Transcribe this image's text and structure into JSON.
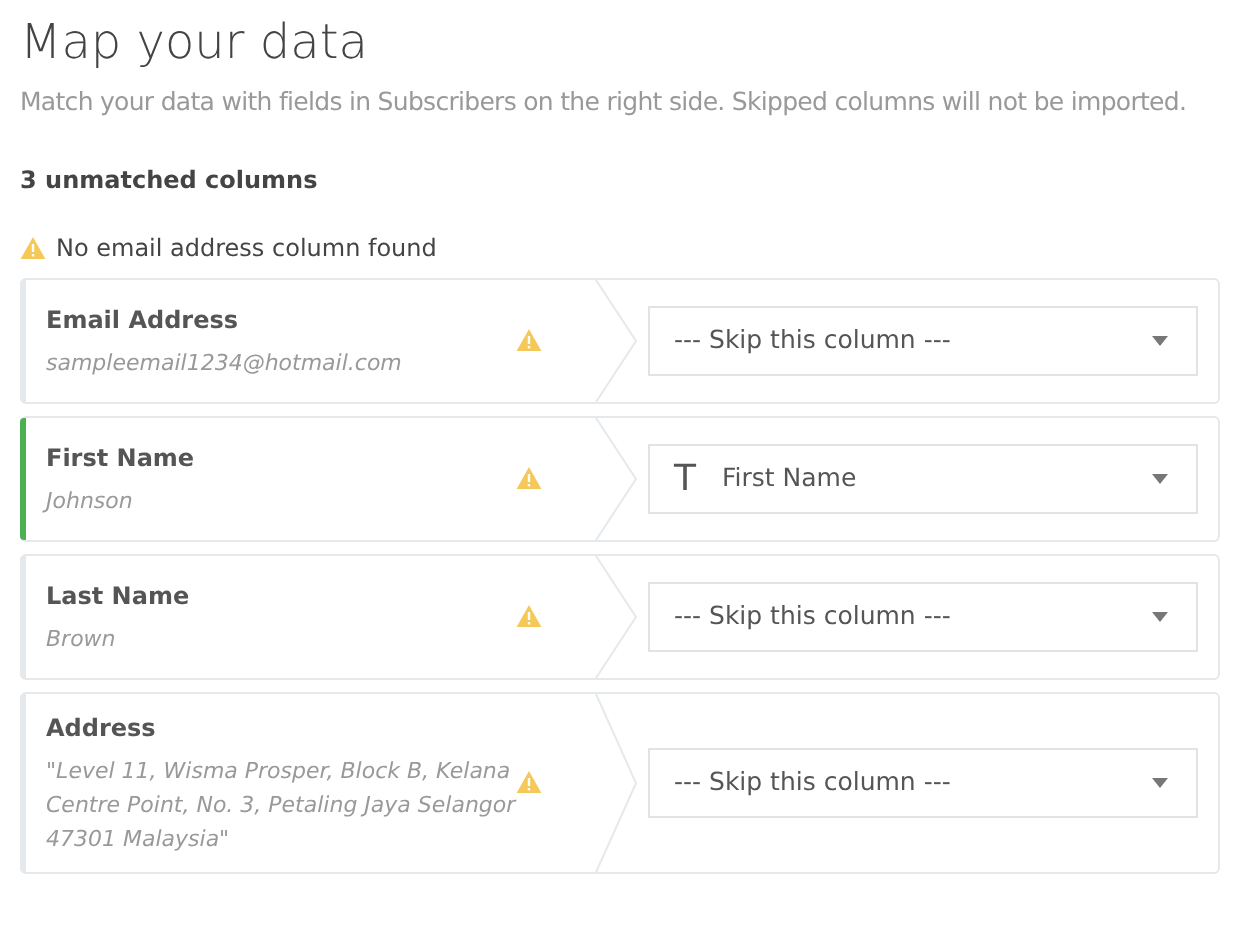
{
  "title": "Map your data",
  "subtitle": "Match your data with fields in Subscribers on the right side. Skipped columns will not be imported.",
  "unmatched_count": "3 unmatched columns",
  "warning": "No email address column found",
  "rows": [
    {
      "name": "Email Address",
      "sample": "sampleemail1234@hotmail.com",
      "selected": false,
      "warning": true,
      "field": {
        "kind": "skip",
        "label": "--- Skip this column ---"
      }
    },
    {
      "name": "First Name",
      "sample": "Johnson",
      "selected": true,
      "warning": true,
      "field": {
        "kind": "text",
        "icon": "T",
        "label": "First Name"
      }
    },
    {
      "name": "Last Name",
      "sample": "Brown",
      "selected": false,
      "warning": true,
      "field": {
        "kind": "skip",
        "label": "--- Skip this column ---"
      }
    },
    {
      "name": "Address",
      "sample": "\"Level 11, Wisma Prosper, Block B, Kelana Centre Point, No. 3, Petaling Jaya Selangor 47301 Malaysia\"",
      "selected": false,
      "warning": true,
      "field": {
        "kind": "skip",
        "label": "--- Skip this column ---"
      }
    }
  ]
}
